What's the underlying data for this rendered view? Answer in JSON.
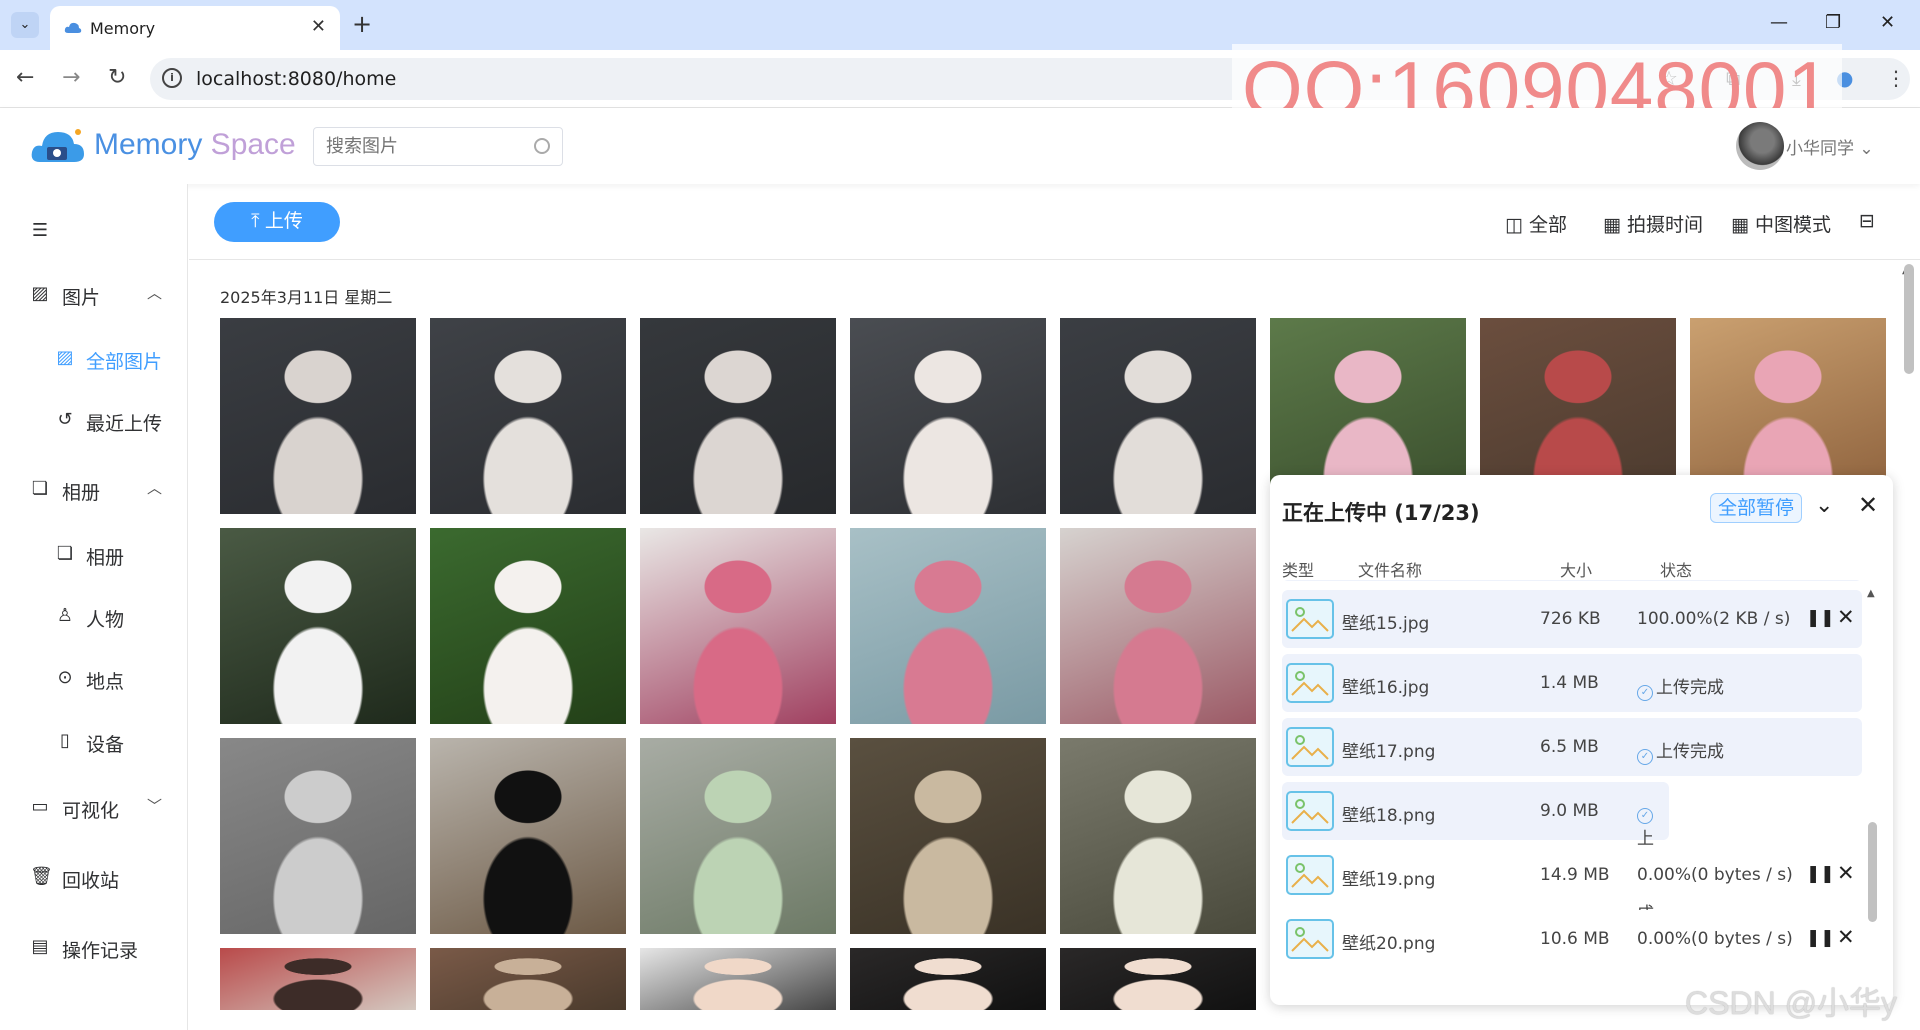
{
  "browser": {
    "tab_title": "Memory",
    "url": "localhost:8080/home",
    "watermark": "QQ:1609048001"
  },
  "header": {
    "brand_a": "Memory",
    "brand_b": " Space",
    "search_placeholder": "搜索图片",
    "username": "小华同学"
  },
  "sidebar": {
    "items": [
      {
        "label": "图片",
        "icon": "image-icon"
      },
      {
        "label": "全部图片",
        "icon": "image-icon"
      },
      {
        "label": "最近上传",
        "icon": "history-icon"
      },
      {
        "label": "相册",
        "icon": "album-icon"
      },
      {
        "label": "相册",
        "icon": "album-icon"
      },
      {
        "label": "人物",
        "icon": "user-icon"
      },
      {
        "label": "地点",
        "icon": "location-icon"
      },
      {
        "label": "设备",
        "icon": "phone-icon"
      },
      {
        "label": "可视化",
        "icon": "monitor-icon"
      },
      {
        "label": "回收站",
        "icon": "trash-icon"
      },
      {
        "label": "操作记录",
        "icon": "document-icon"
      }
    ]
  },
  "toolbar": {
    "upload": "上传",
    "all": "全部",
    "time": "拍摄时间",
    "mode": "中图模式"
  },
  "date_label": "2025年3月11日 星期二",
  "upload_panel": {
    "title": "正在上传中 (17/23)",
    "pause_all": "全部暂停",
    "col_type": "类型",
    "col_name": "文件名称",
    "col_size": "大小",
    "col_status": "状态",
    "files": [
      {
        "name": "壁纸15.jpg",
        "size": "726 KB",
        "status": "100.00%(2 KB / s)"
      },
      {
        "name": "壁纸16.jpg",
        "size": "1.4 MB",
        "status": "上传完成"
      },
      {
        "name": "壁纸17.png",
        "size": "6.5 MB",
        "status": "上传完成"
      },
      {
        "name": "壁纸18.png",
        "size": "9.0 MB",
        "status": "上传完成"
      },
      {
        "name": "壁纸19.png",
        "size": "14.9 MB",
        "status": "0.00%(0 bytes / s)"
      },
      {
        "name": "壁纸20.png",
        "size": "10.6 MB",
        "status": "0.00%(0 bytes / s)"
      }
    ]
  },
  "csdn_watermark": "CSDN @小华y",
  "colors": {
    "accent": "#409eff"
  }
}
